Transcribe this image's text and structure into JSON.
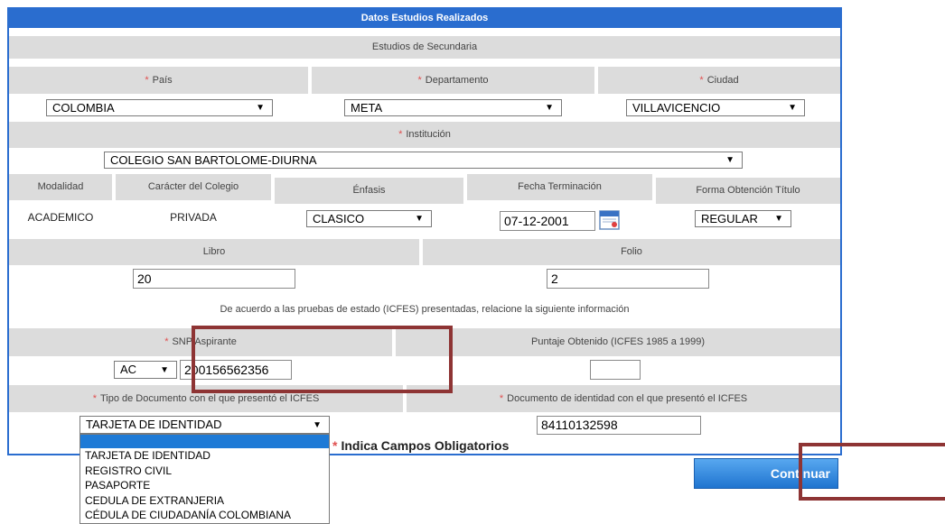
{
  "section_title": "Datos Estudios Realizados",
  "subsection_title": "Estudios de Secundaria",
  "required_mark": "*",
  "pais": {
    "label": "País",
    "value": "COLOMBIA"
  },
  "departamento": {
    "label": "Departamento",
    "value": "META"
  },
  "ciudad": {
    "label": "Ciudad",
    "value": "VILLAVICENCIO"
  },
  "institucion": {
    "label": "Institución",
    "value": "COLEGIO SAN BARTOLOME-DIURNA"
  },
  "modalidad": {
    "label": "Modalidad",
    "value": "ACADEMICO"
  },
  "caracter": {
    "label": "Carácter del Colegio",
    "value": "PRIVADA"
  },
  "enfasis": {
    "label": "Énfasis",
    "value": "CLASICO"
  },
  "fecha": {
    "label": "Fecha Terminación",
    "value": "07-12-2001"
  },
  "forma": {
    "label": "Forma Obtención Título",
    "value": "REGULAR"
  },
  "libro": {
    "label": "Libro",
    "value": "20"
  },
  "folio": {
    "label": "Folio",
    "value": "2"
  },
  "icfes_note": "De acuerdo a las pruebas de estado (ICFES) presentadas, relacione la siguiente información",
  "snp": {
    "label": "SNP Aspirante",
    "prefix": "AC",
    "value": "200156562356"
  },
  "puntaje": {
    "label": "Puntaje Obtenido (ICFES 1985 a 1999)",
    "value": ""
  },
  "tipo_doc": {
    "label": "Tipo de Documento con el que presentó el ICFES",
    "value": "TARJETA DE IDENTIDAD",
    "options": [
      "",
      "TARJETA DE IDENTIDAD",
      "REGISTRO CIVIL",
      "PASAPORTE",
      "CEDULA DE EXTRANJERIA",
      "CÉDULA DE CIUDADANÍA COLOMBIANA"
    ]
  },
  "documento": {
    "label": "Documento de identidad con el que presentó el ICFES",
    "value": "84110132598"
  },
  "obligatorios": "Indica Campos Obligatorios",
  "continuar_button": "Continuar",
  "colors": {
    "header": "#2a6dcf",
    "band": "#dcdcdc",
    "required": "#e05050",
    "highlight_box": "#8e3434"
  }
}
